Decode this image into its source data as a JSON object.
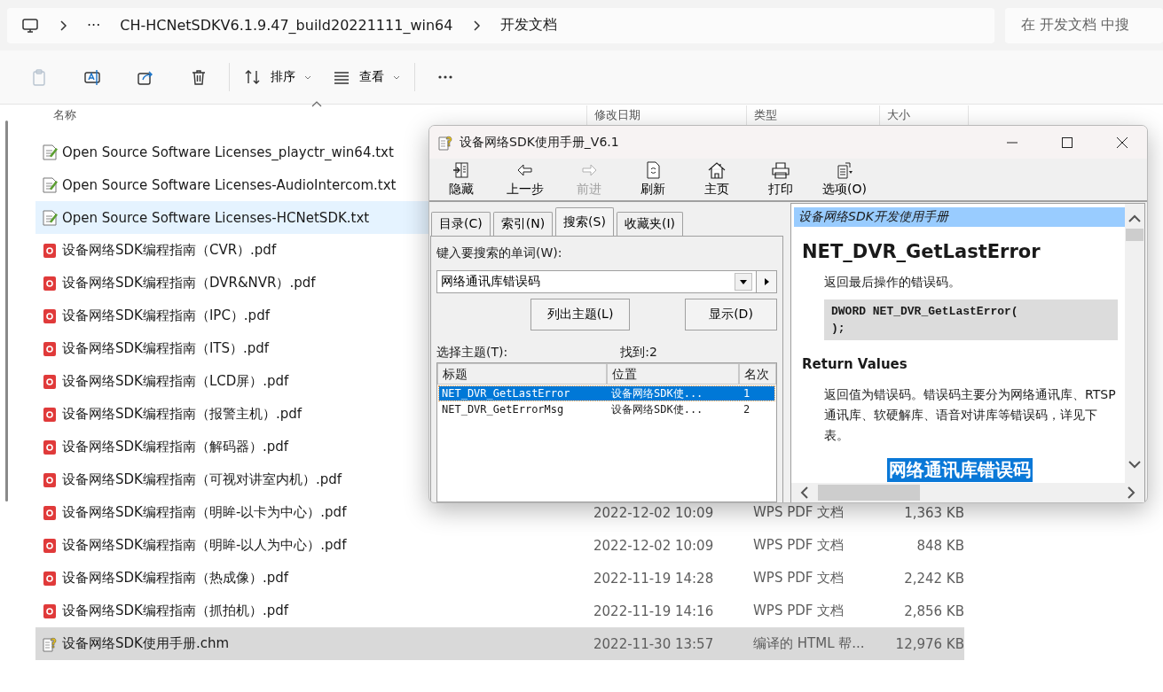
{
  "address_bar": {
    "more": "···",
    "path": [
      "CH-HCNetSDKV6.1.9.47_build20221111_win64",
      "开发文档"
    ]
  },
  "search": {
    "placeholder": "在 开发文档 中搜"
  },
  "toolbar": [
    {
      "disabled": true
    },
    {
      "disabled": false
    },
    {
      "disabled": false
    },
    {
      "disabled": false
    },
    {
      "label": "排序",
      "disabled": false
    },
    {
      "label": "查看",
      "disabled": false
    },
    {
      "disabled": false
    }
  ],
  "columns": [
    "名称",
    "修改日期",
    "类型",
    "大小"
  ],
  "files": [
    {
      "name": "Open Source Software Licenses_playctr_win64.txt",
      "kind": "txt",
      "hovered": false,
      "selected": false
    },
    {
      "name": "Open Source Software Licenses-AudioIntercom.txt",
      "kind": "txt",
      "hovered": false,
      "selected": false
    },
    {
      "name": "Open Source Software Licenses-HCNetSDK.txt",
      "kind": "txt",
      "hovered": true,
      "selected": false
    },
    {
      "name": "设备网络SDK编程指南（CVR）.pdf",
      "kind": "pdf",
      "hovered": false,
      "selected": false
    },
    {
      "name": "设备网络SDK编程指南（DVR&NVR）.pdf",
      "kind": "pdf",
      "hovered": false,
      "selected": false
    },
    {
      "name": "设备网络SDK编程指南（IPC）.pdf",
      "kind": "pdf",
      "hovered": false,
      "selected": false
    },
    {
      "name": "设备网络SDK编程指南（ITS）.pdf",
      "kind": "pdf",
      "hovered": false,
      "selected": false
    },
    {
      "name": "设备网络SDK编程指南（LCD屏）.pdf",
      "kind": "pdf",
      "hovered": false,
      "selected": false
    },
    {
      "name": "设备网络SDK编程指南（报警主机）.pdf",
      "kind": "pdf",
      "hovered": false,
      "selected": false
    },
    {
      "name": "设备网络SDK编程指南（解码器）.pdf",
      "kind": "pdf",
      "hovered": false,
      "selected": false
    },
    {
      "name": "设备网络SDK编程指南（可视对讲室内机）.pdf",
      "kind": "pdf",
      "hovered": false,
      "selected": false
    },
    {
      "name": "设备网络SDK编程指南（明眸-以卡为中心）.pdf",
      "kind": "pdf",
      "date": "2022-12-02 10:09",
      "type": "WPS PDF 文档",
      "size": "1,363 KB",
      "hovered": false,
      "selected": false
    },
    {
      "name": "设备网络SDK编程指南（明眸-以人为中心）.pdf",
      "kind": "pdf",
      "date": "2022-12-02 10:09",
      "type": "WPS PDF 文档",
      "size": "848 KB",
      "hovered": false,
      "selected": false
    },
    {
      "name": "设备网络SDK编程指南（热成像）.pdf",
      "kind": "pdf",
      "date": "2022-11-19 14:28",
      "type": "WPS PDF 文档",
      "size": "2,242 KB",
      "hovered": false,
      "selected": false
    },
    {
      "name": "设备网络SDK编程指南（抓拍机）.pdf",
      "kind": "pdf",
      "date": "2022-11-19 14:16",
      "type": "WPS PDF 文档",
      "size": "2,856 KB",
      "hovered": false,
      "selected": false
    },
    {
      "name": "设备网络SDK使用手册.chm",
      "kind": "chm",
      "date": "2022-11-30 13:57",
      "type": "编译的 HTML 帮...",
      "size": "12,976 KB",
      "hovered": false,
      "selected": true
    }
  ],
  "help_window": {
    "title": "设备网络SDK使用手册_V6.1",
    "toolbar": [
      {
        "label": "隐藏",
        "disabled": false
      },
      {
        "label": "上一步",
        "disabled": false
      },
      {
        "label": "前进",
        "disabled": true
      },
      {
        "label": "刷新",
        "disabled": false
      },
      {
        "label": "主页",
        "disabled": false
      },
      {
        "label": "打印",
        "disabled": false
      },
      {
        "label": "选项(O)",
        "disabled": false
      }
    ],
    "tabs": [
      {
        "label": "目录(C)",
        "selected": false
      },
      {
        "label": "索引(N)",
        "selected": false
      },
      {
        "label": "搜索(S)",
        "selected": true
      },
      {
        "label": "收藏夹(I)",
        "selected": false
      }
    ],
    "search_label": "键入要搜索的单词(W):",
    "search_value": "网络通讯库错误码",
    "buttons": [
      "列出主题(L)",
      "显示(D)"
    ],
    "topics_label": "选择主题(T):",
    "found": "找到:2",
    "result_columns": [
      "标题",
      "位置",
      "名次"
    ],
    "results": [
      {
        "title": "NET_DVR_GetLastError",
        "location": "设备网络SDK使...",
        "rank": "1",
        "selected": true
      },
      {
        "title": "NET_DVR_GetErrorMsg",
        "location": "设备网络SDK使...",
        "rank": "2",
        "selected": false
      }
    ],
    "content": {
      "banner": "设备网络SDK开发使用手册",
      "heading": "NET_DVR_GetLastError",
      "summary": "返回最后操作的错误码。",
      "code": [
        "DWORD NET_DVR_GetLastError(",
        ");"
      ],
      "section": "Return Values",
      "paragraph": "返回值为错误码。错误码主要分为网络通讯库、RTSP通讯库、软硬解库、语音对讲库等错误码，详见下表。",
      "highlight": "网络通讯库错误码"
    }
  }
}
